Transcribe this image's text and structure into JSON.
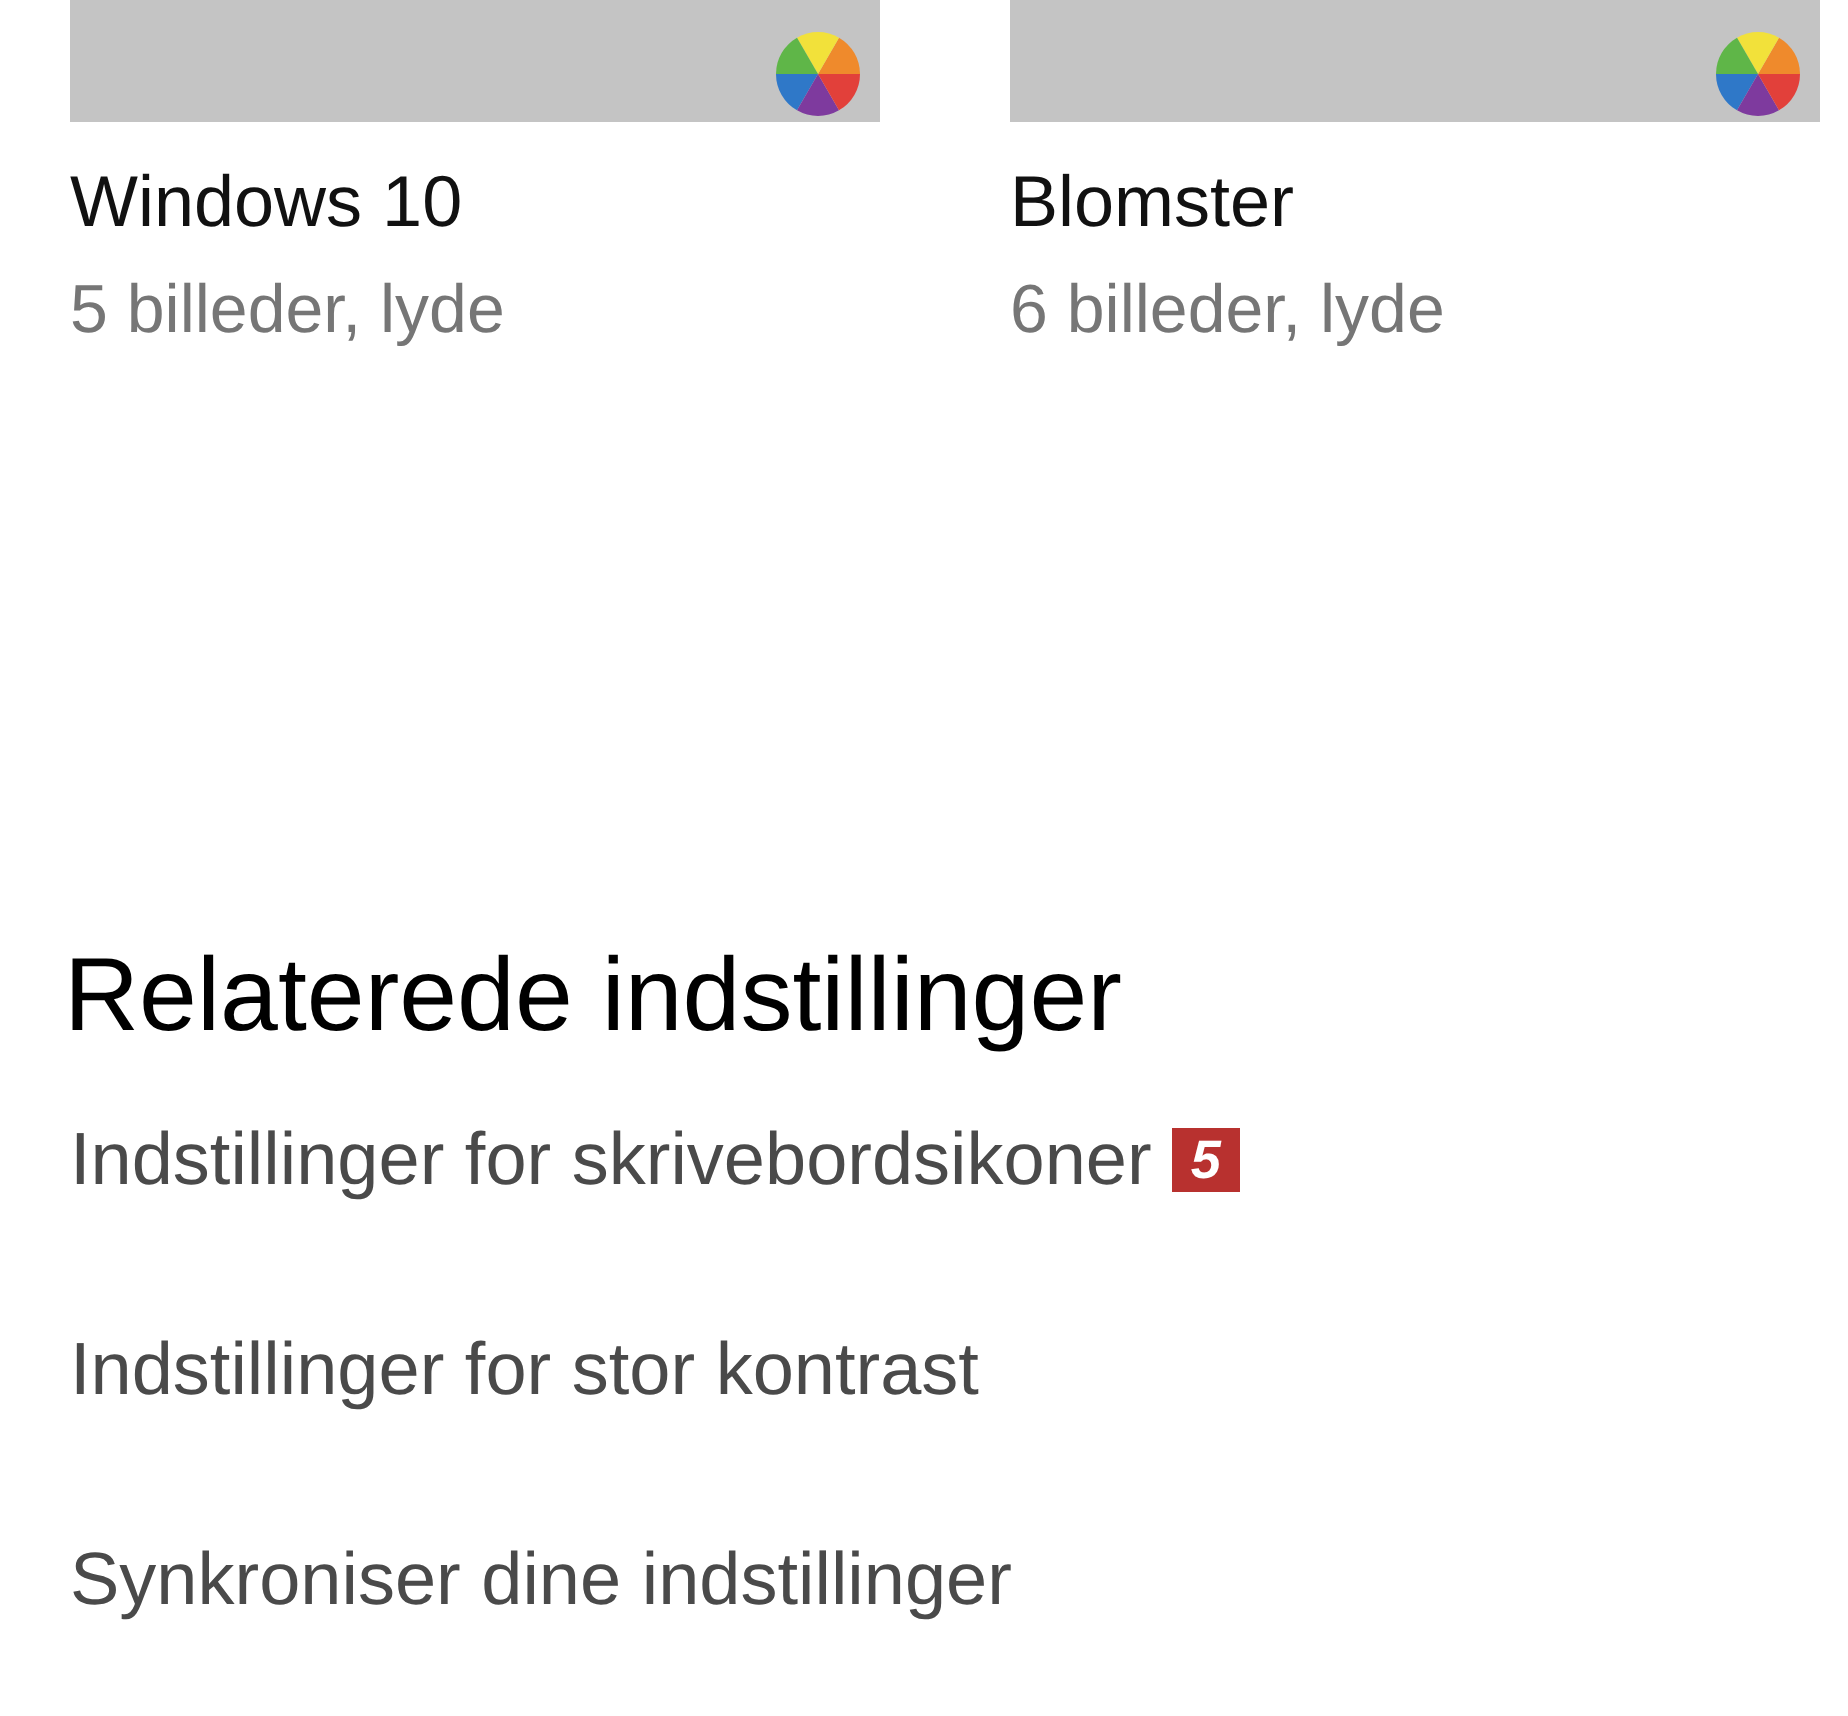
{
  "themes": [
    {
      "title": "Windows 10",
      "subtitle": "5 billeder, lyde"
    },
    {
      "title": "Blomster",
      "subtitle": "6 billeder, lyde"
    }
  ],
  "related_settings": {
    "heading": "Relaterede indstillinger",
    "links": [
      {
        "label": "Indstillinger for skrivebordsikoner",
        "callout": "5"
      },
      {
        "label": "Indstillinger for stor kontrast"
      },
      {
        "label": "Synkroniser dine indstillinger"
      }
    ]
  }
}
